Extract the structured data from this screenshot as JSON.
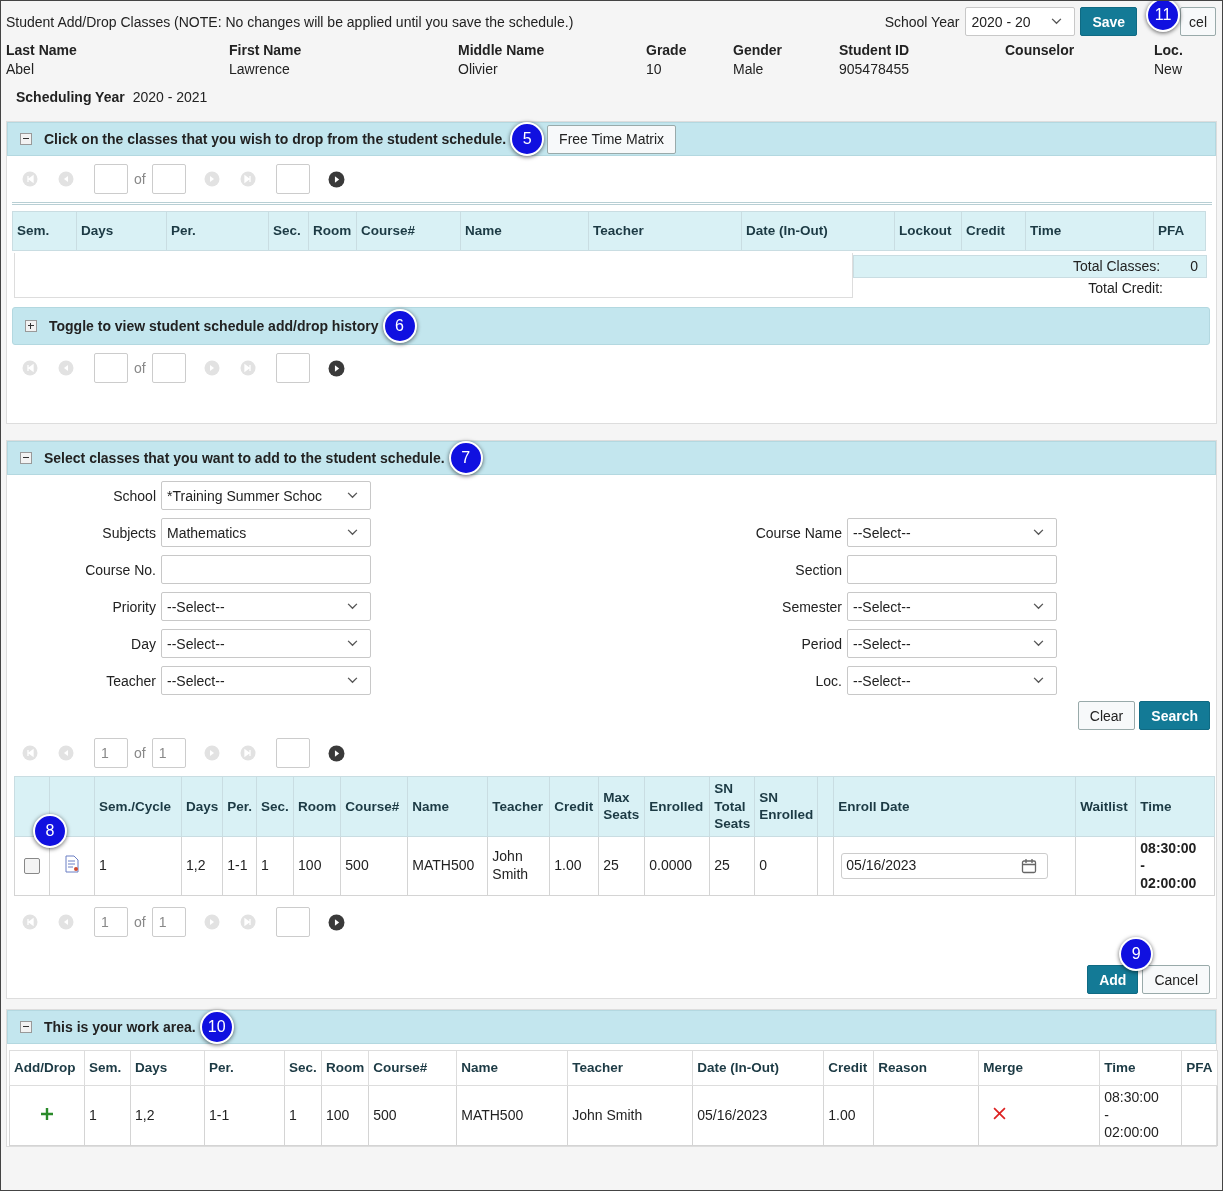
{
  "header": {
    "title": "Student Add/Drop Classes (NOTE: No changes will be applied until you save the schedule.)",
    "school_year_label": "School Year",
    "school_year_value": "2020 - 20",
    "save": "Save",
    "cancel": "cel",
    "callout": "11"
  },
  "student": [
    {
      "label": "Last Name",
      "value": "Abel"
    },
    {
      "label": "First Name",
      "value": "Lawrence"
    },
    {
      "label": "Middle Name",
      "value": "Olivier"
    },
    {
      "label": "Grade",
      "value": "10"
    },
    {
      "label": "Gender",
      "value": "Male"
    },
    {
      "label": "Student ID",
      "value": "905478455"
    },
    {
      "label": "Counselor"
    },
    {
      "label": "Loc.",
      "value": "New"
    }
  ],
  "scheduling_year": {
    "label": "Scheduling Year",
    "value": "2020 - 2021"
  },
  "drop_section": {
    "title": "Click on the classes that you wish to drop from the student schedule.",
    "expanded": true,
    "callout": "5",
    "button": "Free Time Matrix",
    "pager": {
      "of": "of"
    },
    "columns": [
      "Sem.",
      "Days",
      "Per.",
      "Sec.",
      "Room",
      "Course#",
      "Name",
      "Teacher",
      "Date (In-Out)",
      "Lockout",
      "Credit",
      "Time",
      "PFA"
    ],
    "total_classes_label": "Total Classes:",
    "total_classes": "0",
    "total_credit_label": "Total Credit:"
  },
  "history_section": {
    "title": "Toggle to view student schedule add/drop history",
    "expanded": false,
    "callout": "6",
    "pager": {
      "of": "of"
    }
  },
  "add_section": {
    "title": "Select classes that you want to add to the student schedule.",
    "expanded": true,
    "callout": "7",
    "filters_left": [
      {
        "label": "School",
        "kind": "select",
        "value": "*Training Summer Schoc"
      },
      {
        "label": "Subjects",
        "kind": "select",
        "value": "Mathematics"
      },
      {
        "label": "Course No.",
        "kind": "text"
      },
      {
        "label": "Priority",
        "kind": "select",
        "value": "--Select--"
      },
      {
        "label": "Day",
        "kind": "select",
        "value": "--Select--"
      },
      {
        "label": "Teacher",
        "kind": "select",
        "value": "--Select--"
      }
    ],
    "filters_right": [
      {
        "label": "Course Name",
        "kind": "select",
        "value": "--Select--"
      },
      {
        "label": "Section",
        "kind": "text"
      },
      {
        "label": "Semester",
        "kind": "select",
        "value": "--Select--"
      },
      {
        "label": "Period",
        "kind": "select",
        "value": "--Select--"
      },
      {
        "label": "Loc.",
        "kind": "select",
        "value": "--Select--"
      }
    ],
    "clear": "Clear",
    "search": "Search",
    "pager_top": {
      "of": "of",
      "page": "1",
      "total": "1"
    },
    "results": {
      "columns": [
        {
          "kind": "check"
        },
        {
          "kind": "icon"
        },
        {
          "label": "Sem./Cycle",
          "kind": "text"
        },
        {
          "label": "Days",
          "kind": "text"
        },
        {
          "label": "Per.",
          "kind": "text"
        },
        {
          "label": "Sec.",
          "kind": "text"
        },
        {
          "label": "Room",
          "kind": "text"
        },
        {
          "label": "Course#",
          "kind": "text"
        },
        {
          "label": "Name",
          "kind": "text"
        },
        {
          "label": "Teacher",
          "kind": "text"
        },
        {
          "label": "Credit",
          "kind": "text"
        },
        {
          "label": "Max Seats",
          "kind": "text"
        },
        {
          "label": "Enrolled",
          "kind": "text"
        },
        {
          "label": "SN Total Seats",
          "kind": "text"
        },
        {
          "label": "SN Enrolled",
          "kind": "text"
        },
        {
          "kind": "blank"
        },
        {
          "label": "Enroll Date",
          "kind": "date"
        },
        {
          "label": "Waitlist",
          "kind": "blank"
        },
        {
          "label": "Time",
          "kind": "time"
        }
      ],
      "rows": [
        {
          "checked": false,
          "values": [
            "1",
            "1,2",
            "1-1",
            "1",
            "100",
            "500",
            "MATH500",
            "John Smith",
            "1.00",
            "25",
            "0.0000",
            "25",
            "0"
          ],
          "enroll_date": "05/16/2023",
          "time": [
            "08:30:00",
            "-",
            "02:00:00"
          ]
        }
      ]
    },
    "callout_results": "8",
    "pager_bottom": {
      "of": "of",
      "page": "1",
      "total": "1"
    },
    "add": "Add",
    "cancel": "Cancel",
    "callout_add": "9"
  },
  "work_area": {
    "title": "This is your work area.",
    "expanded": true,
    "callout": "10",
    "columns": [
      {
        "label": "Add/Drop",
        "kind": "action"
      },
      {
        "label": "Sem.",
        "kind": "text"
      },
      {
        "label": "Days",
        "kind": "text"
      },
      {
        "label": "Per.",
        "kind": "text"
      },
      {
        "label": "Sec.",
        "kind": "text"
      },
      {
        "label": "Room",
        "kind": "text"
      },
      {
        "label": "Course#",
        "kind": "text"
      },
      {
        "label": "Name",
        "kind": "text"
      },
      {
        "label": "Teacher",
        "kind": "text"
      },
      {
        "label": "Date (In-Out)",
        "kind": "text"
      },
      {
        "label": "Credit",
        "kind": "text"
      },
      {
        "label": "Reason",
        "kind": "blank"
      },
      {
        "label": "Merge",
        "kind": "merge"
      },
      {
        "label": "Time",
        "kind": "time"
      },
      {
        "label": "PFA",
        "kind": "blank"
      }
    ],
    "rows": [
      {
        "added": true,
        "merge": true,
        "values": [
          "1",
          "1,2",
          "1-1",
          "1",
          "100",
          "500",
          "MATH500",
          "John Smith",
          "05/16/2023",
          "1.00"
        ],
        "time": [
          "08:30:00",
          "-",
          "02:00:00"
        ]
      }
    ]
  }
}
